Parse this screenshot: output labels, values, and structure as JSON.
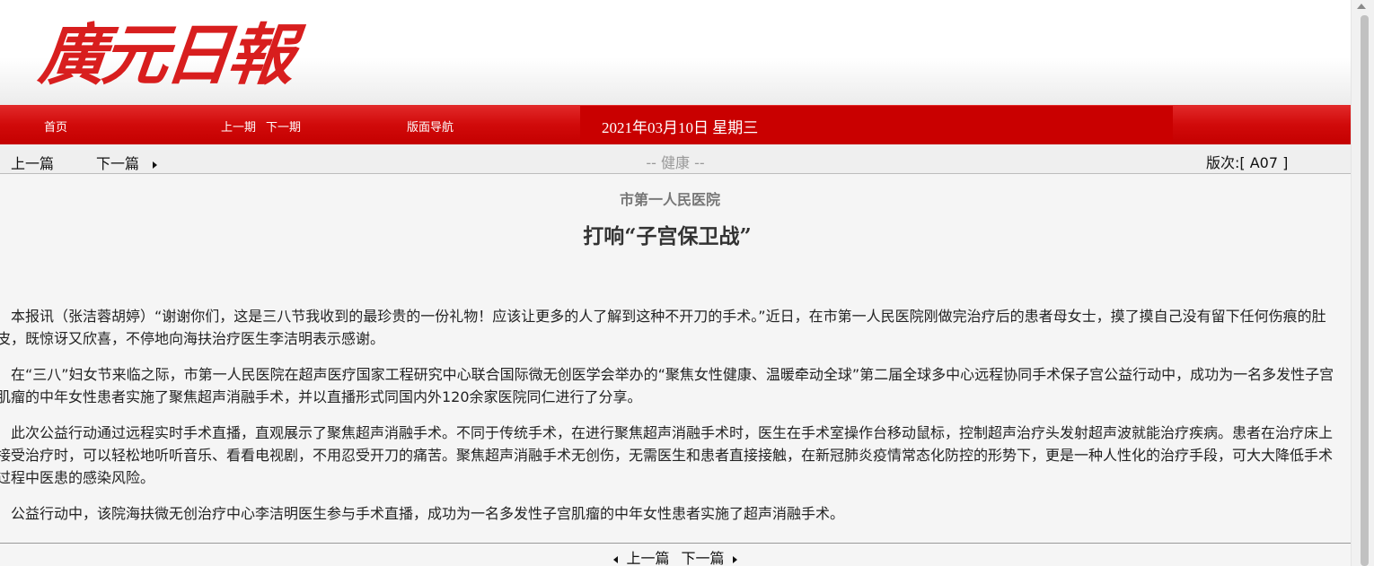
{
  "masthead": {
    "logo_text": "廣元日報"
  },
  "nav": {
    "home": "首页",
    "prev_issue": "上一期",
    "next_issue": "下一期",
    "page_nav": "版面导航",
    "date": "2021年03月10日 星期三"
  },
  "subbar": {
    "prev_article": "上一篇",
    "next_article": "下一篇",
    "section": "-- 健康 --",
    "edition": "版次:[ A07 ]"
  },
  "article": {
    "pretitle": "市第一人民医院",
    "headline": "打响“子宫保卫战”",
    "paragraphs": [
      "本报讯（张洁蓉胡婷）“谢谢你们，这是三八节我收到的最珍贵的一份礼物！应该让更多的人了解到这种不开刀的手术。”近日，在市第一人民医院刚做完治疗后的患者母女士，摸了摸自己没有留下任何伤痕的肚皮，既惊讶又欣喜，不停地向海扶治疗医生李洁明表示感谢。",
      "在“三八”妇女节来临之际，市第一人民医院在超声医疗国家工程研究中心联合国际微无创医学会举办的“聚焦女性健康、温暖牵动全球”第二届全球多中心远程协同手术保子宫公益行动中，成功为一名多发性子宫肌瘤的中年女性患者实施了聚焦超声消融手术，并以直播形式同国内外120余家医院同仁进行了分享。",
      "此次公益行动通过远程实时手术直播，直观展示了聚焦超声消融手术。不同于传统手术，在进行聚焦超声消融手术时，医生在手术室操作台移动鼠标，控制超声治疗头发射超声波就能治疗疾病。患者在治疗床上接受治疗时，可以轻松地听听音乐、看看电视剧，不用忍受开刀的痛苦。聚焦超声消融手术无创伤，无需医生和患者直接接触，在新冠肺炎疫情常态化防控的形势下，更是一种人性化的治疗手段，可大大降低手术过程中医患的感染风险。",
      "公益行动中，该院海扶微无创治疗中心李洁明医生参与手术直播，成功为一名多发性子宫肌瘤的中年女性患者实施了超声消融手术。"
    ]
  },
  "bottom_nav": {
    "prev_article": "上一篇",
    "next_article": "下一篇"
  },
  "colors": {
    "brand_red": "#d81e1e",
    "nav_red": "#cc0000",
    "background": "#f5f5f5"
  }
}
